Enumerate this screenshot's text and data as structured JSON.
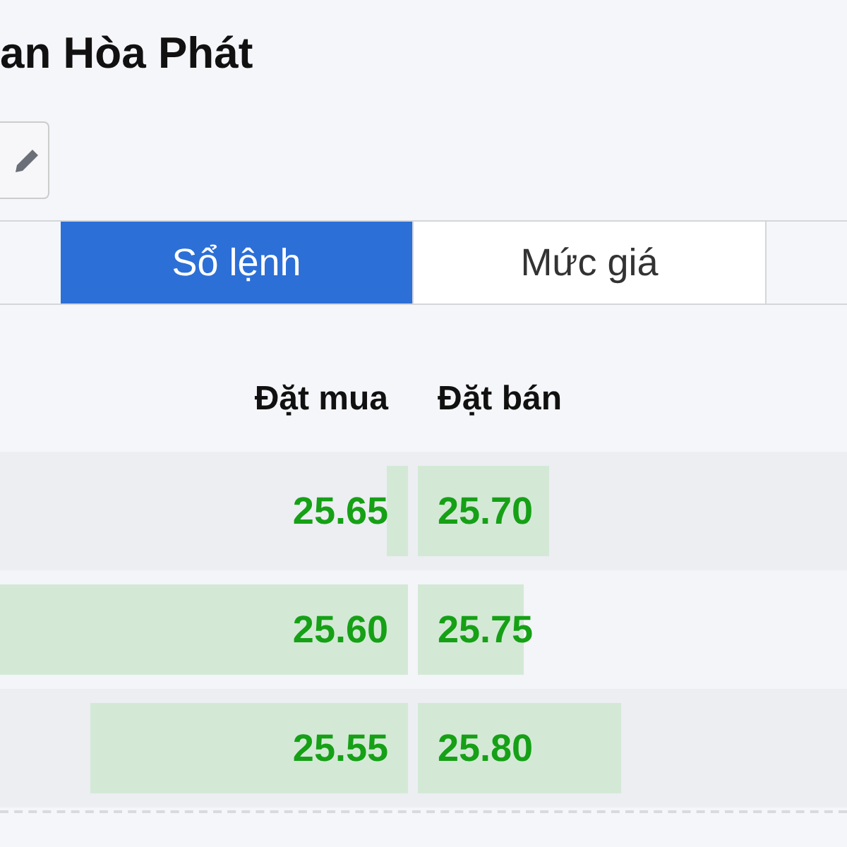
{
  "title": "an Hòa Phát",
  "tabs": [
    {
      "label": "Sổ lệnh",
      "selected": true
    },
    {
      "label": "Mức giá",
      "selected": false
    }
  ],
  "order_book": {
    "columns": [
      "Đặt mua",
      "Đặt bán"
    ],
    "rows": [
      {
        "bid": {
          "price": "25.65"
        },
        "ask": {
          "price": "25.70"
        }
      },
      {
        "bid": {
          "price": "25.60"
        },
        "ask": {
          "price": "25.75"
        }
      },
      {
        "bid": {
          "price": "25.55"
        },
        "ask": {
          "price": "25.80"
        }
      }
    ]
  }
}
